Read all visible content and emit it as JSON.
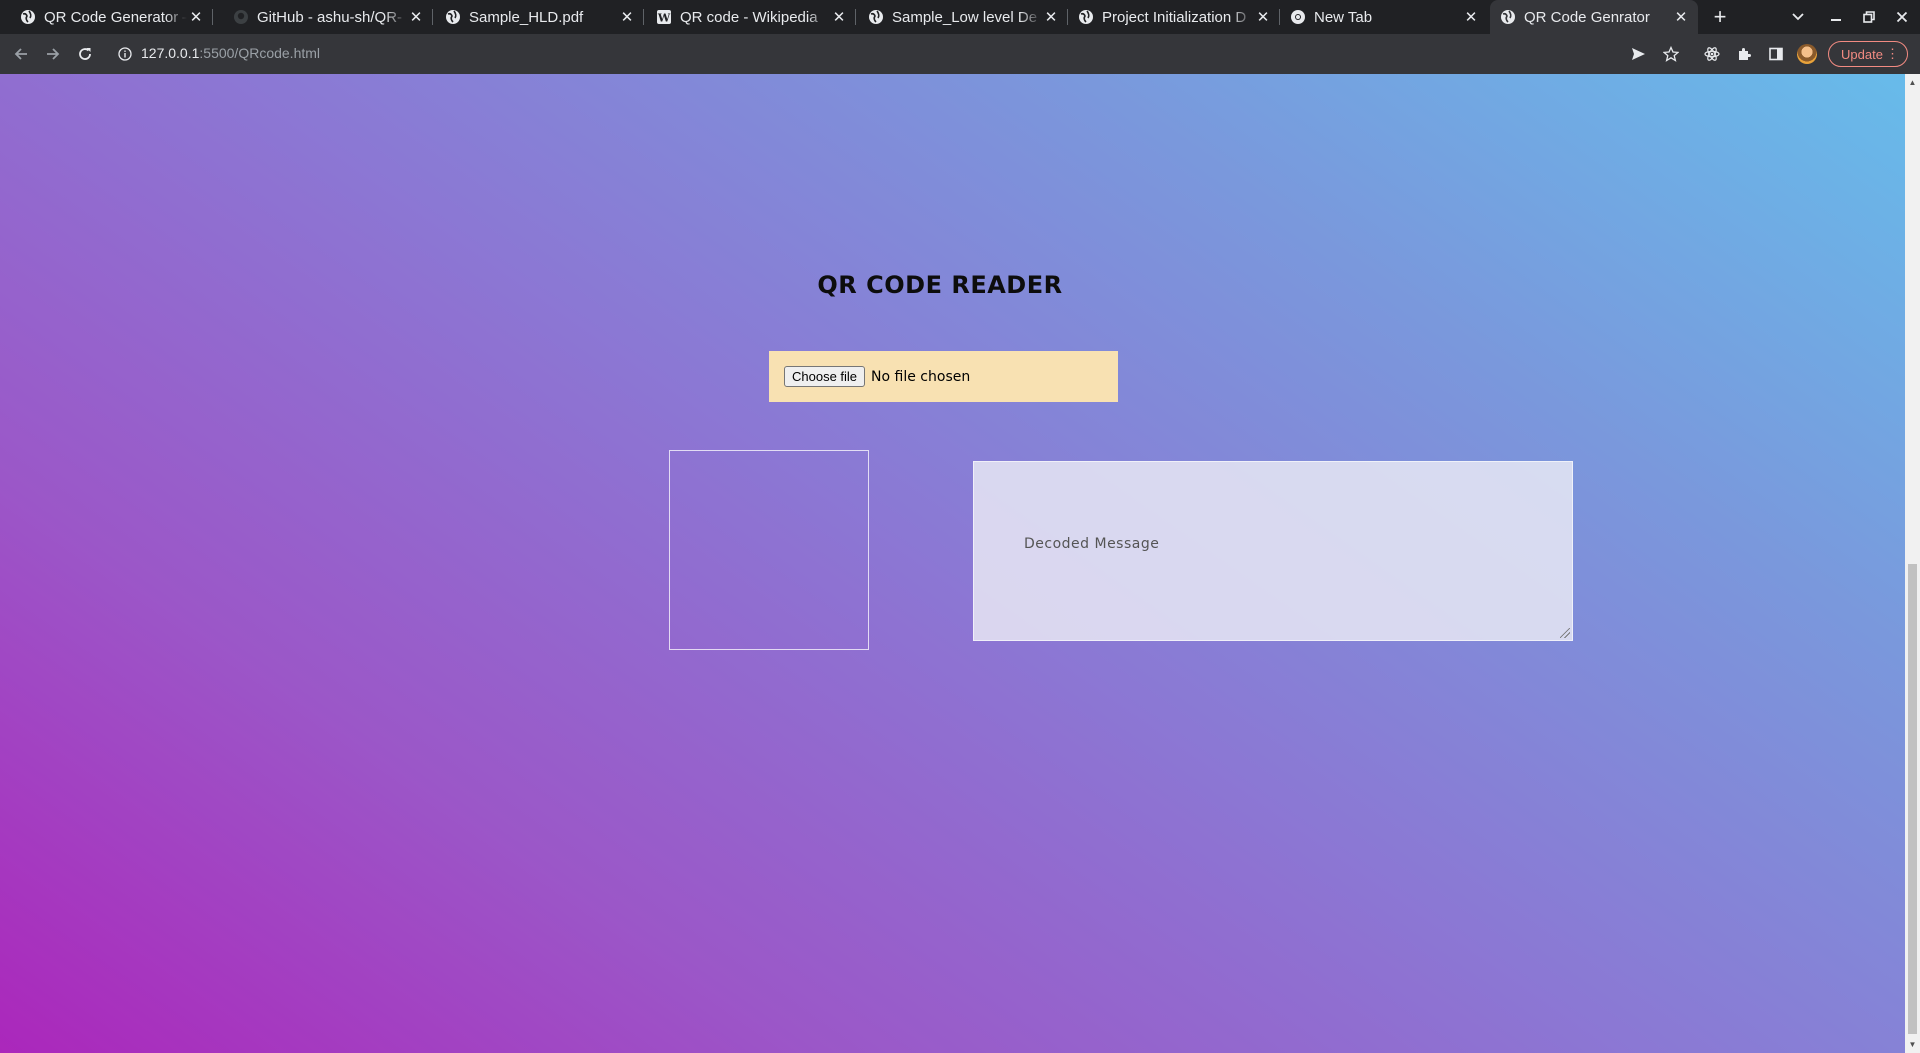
{
  "browser": {
    "tabs": [
      {
        "title": "QR Code Generator – ",
        "icon": "globe-icon",
        "active": false
      },
      {
        "title": "GitHub - ashu-sh/QR-",
        "icon": "github-icon",
        "active": false
      },
      {
        "title": "Sample_HLD.pdf",
        "icon": "globe-icon",
        "active": false
      },
      {
        "title": "QR code - Wikipedia",
        "icon": "wikipedia-icon",
        "active": false
      },
      {
        "title": "Sample_Low level De",
        "icon": "globe-icon",
        "active": false
      },
      {
        "title": "Project Initialization D",
        "icon": "globe-icon",
        "active": false
      },
      {
        "title": "New Tab",
        "icon": "chrome-icon",
        "active": false
      },
      {
        "title": "QR Code Genrator",
        "icon": "globe-icon",
        "active": true
      }
    ],
    "new_tab_symbol": "+",
    "url_host": "127.0.0.1",
    "url_rest": ":5500/QRcode.html",
    "update_label": "Update",
    "update_color": "#f28b82"
  },
  "page": {
    "heading": "QR CODE READER",
    "file_button_label": "Choose file",
    "file_status": "No file chosen",
    "message_placeholder": "Decoded Message",
    "filebox_color": "#f8e1b2",
    "gradient_colors": [
      "#ab27bb",
      "#8b78d4",
      "#67bbea"
    ]
  }
}
